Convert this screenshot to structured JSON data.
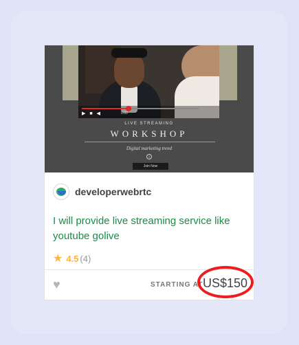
{
  "thumbnail": {
    "live_label": "LIVE STREAMING",
    "workshop_label": "WORKSHOP",
    "subtitle": "Digital marketing trend",
    "info_glyph": "i",
    "join_label": "Join Now",
    "video_controls": "▶ ■ ◀",
    "video_time": "0:00",
    "progress_fraction": 0.4
  },
  "seller": {
    "name": "developerwebrtc",
    "avatar_icon": "developer-logo-icon"
  },
  "gig": {
    "title": "I will provide live streaming service like youtube golive"
  },
  "rating": {
    "star_icon": "star-icon",
    "value": "4.5",
    "count": "(4)"
  },
  "footer": {
    "heart_icon": "heart-icon",
    "starting_label": "STARTING AT",
    "price": "US$150"
  },
  "colors": {
    "title_green": "#1b8a46",
    "star": "#ffb33e",
    "annotation_red": "#ee1c1c"
  }
}
